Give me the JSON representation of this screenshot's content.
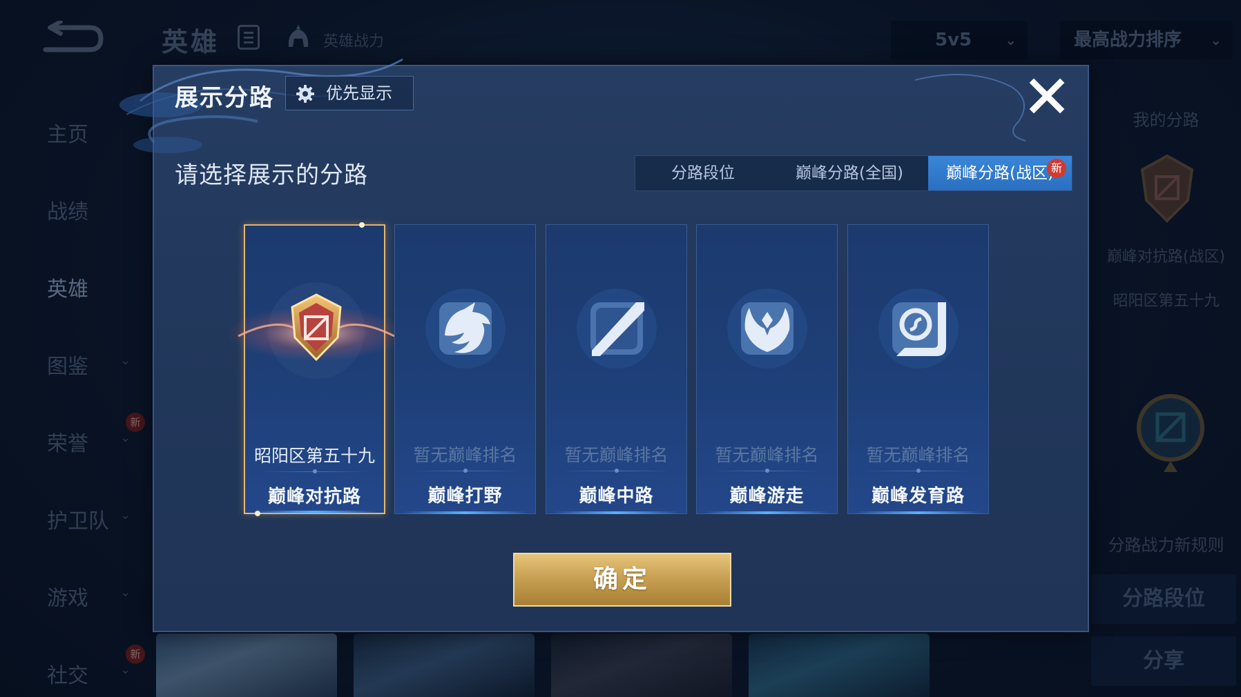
{
  "background": {
    "title": "英雄",
    "power_label": "英雄战力",
    "mode_select": "5v5",
    "sort_select": "最高战力排序",
    "sidebar": [
      {
        "label": "主页",
        "chevron": false,
        "new": false,
        "active": false
      },
      {
        "label": "战绩",
        "chevron": false,
        "new": false,
        "active": false
      },
      {
        "label": "英雄",
        "chevron": false,
        "new": false,
        "active": true
      },
      {
        "label": "图鉴",
        "chevron": true,
        "new": false,
        "active": false
      },
      {
        "label": "荣誉",
        "chevron": true,
        "new": true,
        "active": false
      },
      {
        "label": "护卫队",
        "chevron": true,
        "new": false,
        "active": false
      },
      {
        "label": "游戏",
        "chevron": true,
        "new": false,
        "active": false
      },
      {
        "label": "社交",
        "chevron": true,
        "new": true,
        "active": false
      }
    ],
    "new_badge": "新",
    "right_panel": {
      "heading": "我的分路",
      "lane_name": "巅峰对抗路(战区)",
      "rank": "昭阳区第五十九",
      "rules_link": "分路战力新规则",
      "lane_rank_button": "分路段位",
      "share_button": "分享"
    }
  },
  "modal": {
    "title": "展示分路",
    "priority_button": "优先显示",
    "prompt": "请选择展示的分路",
    "tabs": [
      {
        "label": "分路段位",
        "active": false
      },
      {
        "label": "巅峰分路(全国)",
        "active": false
      },
      {
        "label": "巅峰分路(战区)",
        "active": true,
        "badge": "新"
      }
    ],
    "lanes": [
      {
        "rank": "昭阳区第五十九",
        "name": "巅峰对抗路",
        "selected": true,
        "icon": "clash-lane-crest-icon"
      },
      {
        "rank": "暂无巅峰排名",
        "name": "巅峰打野",
        "selected": false,
        "icon": "jungle-dragon-icon"
      },
      {
        "rank": "暂无巅峰排名",
        "name": "巅峰中路",
        "selected": false,
        "icon": "mid-lane-icon"
      },
      {
        "rank": "暂无巅峰排名",
        "name": "巅峰游走",
        "selected": false,
        "icon": "roam-wings-icon"
      },
      {
        "rank": "暂无巅峰排名",
        "name": "巅峰发育路",
        "selected": false,
        "icon": "farm-lane-icon"
      }
    ],
    "confirm_button": "确定"
  },
  "colors": {
    "accent_blue": "#2a6fc0",
    "gold": "#c9a154",
    "selected_border": "#e8b76a",
    "new_badge": "#d13a32"
  }
}
